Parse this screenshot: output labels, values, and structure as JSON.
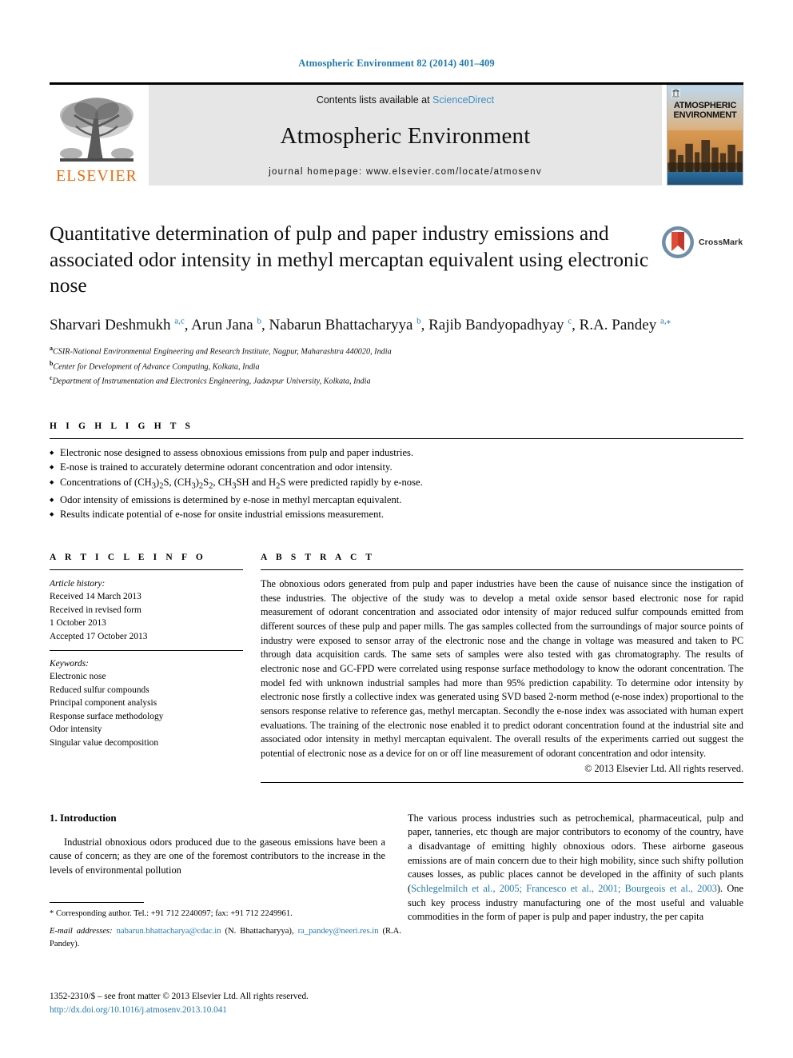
{
  "running_head": "Atmospheric Environment 82 (2014) 401–409",
  "masthead": {
    "publisher": "ELSEVIER",
    "contents_prefix": "Contents lists available at ",
    "sciencedirect": "ScienceDirect",
    "journal_title": "Atmospheric Environment",
    "homepage": "journal homepage: www.elsevier.com/locate/atmosenv",
    "cover_title_line1": "ATMOSPHERIC",
    "cover_title_line2": "ENVIRONMENT"
  },
  "article": {
    "title": "Quantitative determination of pulp and paper industry emissions and associated odor intensity in methyl mercaptan equivalent using electronic nose",
    "crossmark_label": "CrossMark",
    "authors_html": "Sharvari Deshmukh <sup>a,c</sup>, Arun Jana <sup>b</sup>, Nabarun Bhattacharyya <sup>b</sup>, Rajib Bandyopadhyay <sup>c</sup>, R.A. Pandey <sup>a,⁎</sup>",
    "affiliations": [
      {
        "mark": "a",
        "text": "CSIR-National Environmental Engineering and Research Institute, Nagpur, Maharashtra 440020, India"
      },
      {
        "mark": "b",
        "text": "Center for Development of Advance Computing, Kolkata, India"
      },
      {
        "mark": "c",
        "text": "Department of Instrumentation and Electronics Engineering, Jadavpur University, Kolkata, India"
      }
    ]
  },
  "highlights": {
    "heading": "H I G H L I G H T S",
    "items_html": [
      "Electronic nose designed to assess obnoxious emissions from pulp and paper industries.",
      "E-nose is trained to accurately determine odorant concentration and odor intensity.",
      "Concentrations of (CH<sub>3</sub>)<sub>2</sub>S, (CH<sub>3</sub>)<sub>2</sub>S<sub>2</sub>, CH<sub>3</sub>SH and H<sub>2</sub>S were predicted rapidly by e-nose.",
      "Odor intensity of emissions is determined by e-nose in methyl mercaptan equivalent.",
      "Results indicate potential of e-nose for onsite industrial emissions measurement."
    ]
  },
  "article_info": {
    "heading": "A R T I C L E  I N F O",
    "history_label": "Article history:",
    "history_lines": [
      "Received 14 March 2013",
      "Received in revised form",
      "1 October 2013",
      "Accepted 17 October 2013"
    ],
    "keywords_label": "Keywords:",
    "keywords": [
      "Electronic nose",
      "Reduced sulfur compounds",
      "Principal component analysis",
      "Response surface methodology",
      "Odor intensity",
      "Singular value decomposition"
    ]
  },
  "abstract": {
    "heading": "A B S T R A C T",
    "text": "The obnoxious odors generated from pulp and paper industries have been the cause of nuisance since the instigation of these industries. The objective of the study was to develop a metal oxide sensor based electronic nose for rapid measurement of odorant concentration and associated odor intensity of major reduced sulfur compounds emitted from different sources of these pulp and paper mills. The gas samples collected from the surroundings of major source points of industry were exposed to sensor array of the electronic nose and the change in voltage was measured and taken to PC through data acquisition cards. The same sets of samples were also tested with gas chromatography. The results of electronic nose and GC-FPD were correlated using response surface methodology to know the odorant concentration. The model fed with unknown industrial samples had more than 95% prediction capability. To determine odor intensity by electronic nose firstly a collective index was generated using SVD based 2-norm method (e-nose index) proportional to the sensors response relative to reference gas, methyl mercaptan. Secondly the e-nose index was associated with human expert evaluations. The training of the electronic nose enabled it to predict odorant concentration found at the industrial site and associated odor intensity in methyl mercaptan equivalent. The overall results of the experiments carried out suggest the potential of electronic nose as a device for on or off line measurement of odorant concentration and odor intensity.",
    "copyright": "© 2013 Elsevier Ltd. All rights reserved."
  },
  "introduction": {
    "section_number_title": "1.  Introduction",
    "left_paragraph": "Industrial obnoxious odors produced due to the gaseous emissions have been a cause of concern; as they are one of the foremost contributors to the increase in the levels of environmental pollution",
    "right_paragraph_part1": "The various process industries such as petrochemical, pharmaceutical, pulp and paper, tanneries, etc though are major contributors to economy of the country, have a disadvantage of emitting highly obnoxious odors. These airborne gaseous emissions are of main concern due to their high mobility, since such shifty pollution causes losses, as public places cannot be developed in the affinity of such plants (",
    "right_citation": "Schlegelmilch et al., 2005; Francesco et al., 2001; Bourgeois et al., 2003",
    "right_paragraph_part2": "). One such key process industry manufacturing one of the most useful and valuable commodities in the form of paper is pulp and paper industry, the per capita"
  },
  "footnotes": {
    "corresponding": "* Corresponding author. Tel.: +91 712 2240097; fax: +91 712 2249961.",
    "email_label": "E-mail addresses:",
    "email1": "nabarun.bhattacharya@cdac.in",
    "email1_owner": "(N. Bhattacharyya),",
    "email2": "ra_pandey@neeri.res.in",
    "email2_owner": "(R.A. Pandey).",
    "issn_line": "1352-2310/$ – see front matter © 2013 Elsevier Ltd. All rights reserved.",
    "doi": "http://dx.doi.org/10.1016/j.atmosenv.2013.10.041"
  },
  "colors": {
    "link_blue": "#1f7ab0",
    "sciencedirect_blue": "#3a8fc4",
    "elsevier_orange": "#ec6607",
    "banner_gray": "#e6e6e6"
  }
}
